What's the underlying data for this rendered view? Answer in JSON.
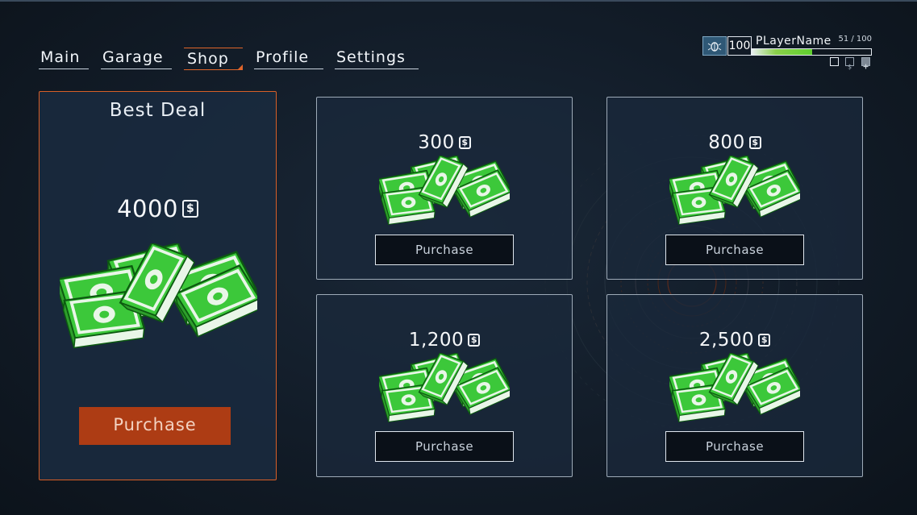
{
  "nav": {
    "tabs": [
      {
        "label": "Main"
      },
      {
        "label": "Garage"
      },
      {
        "label": "Shop"
      },
      {
        "label": "Profile"
      },
      {
        "label": "Settings"
      }
    ],
    "active_tab": "Shop"
  },
  "player": {
    "level": "100",
    "name": "PLayerName",
    "xp_text": "51 / 100",
    "xp_progress": 0.51,
    "icon": "bug-icon"
  },
  "best_deal": {
    "title": "Best Deal",
    "amount": "4000",
    "currency_symbol": "$",
    "button_label": "Purchase"
  },
  "offers": [
    {
      "amount": "300",
      "currency_symbol": "$",
      "button_label": "Purchase"
    },
    {
      "amount": "800",
      "currency_symbol": "$",
      "button_label": "Purchase"
    },
    {
      "amount": "1,200",
      "currency_symbol": "$",
      "button_label": "Purchase"
    },
    {
      "amount": "2,500",
      "currency_symbol": "$",
      "button_label": "Purchase"
    }
  ],
  "colors": {
    "accent": "#e0652a",
    "button_orange": "#ad3c14",
    "money_green": "#3cc83a",
    "xp_green": "#5fcf2e"
  },
  "icons": {
    "money": "cash-stack-icon",
    "currency": "dollar-icon"
  }
}
